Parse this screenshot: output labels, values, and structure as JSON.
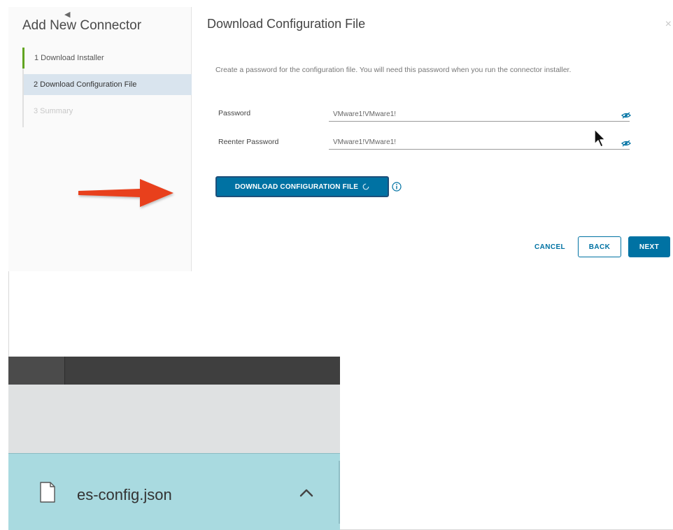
{
  "wizard": {
    "title": "Add New Connector",
    "steps": [
      {
        "label": "1  Download Installer",
        "state": "done"
      },
      {
        "label": "2  Download Configuration File",
        "state": "active"
      },
      {
        "label": "3  Summary",
        "state": "disabled"
      }
    ]
  },
  "main": {
    "title": "Download Configuration File",
    "close_glyph": "×",
    "description": "Create a password for the configuration file. You will need this password when you run the connector installer.",
    "fields": [
      {
        "label": "Password",
        "value": "VMware1!VMware1!"
      },
      {
        "label": "Reenter Password",
        "value": "VMware1!VMware1!"
      }
    ],
    "download_button": "DOWNLOAD CONFIGURATION FILE",
    "cancel_button": "CANCEL",
    "back_button": "BACK",
    "next_button": "NEXT"
  },
  "download_bar": {
    "file_name": "es-config.json"
  },
  "colors": {
    "primary": "#0072a3",
    "step_done": "#62a420",
    "step_active_bg": "#d9e4ee",
    "arrow": "#e8401c",
    "download_bar_bg": "#a9dae0",
    "tabstrip_bg": "#4b4b4b"
  },
  "icons": {
    "eye": "eye-slash-icon",
    "info": "info-circle-icon",
    "spinner": "spinner-icon",
    "file": "file-icon",
    "chevron": "chevron-up-icon",
    "arrow": "red-arrow-icon",
    "cursor": "mouse-cursor-icon"
  }
}
